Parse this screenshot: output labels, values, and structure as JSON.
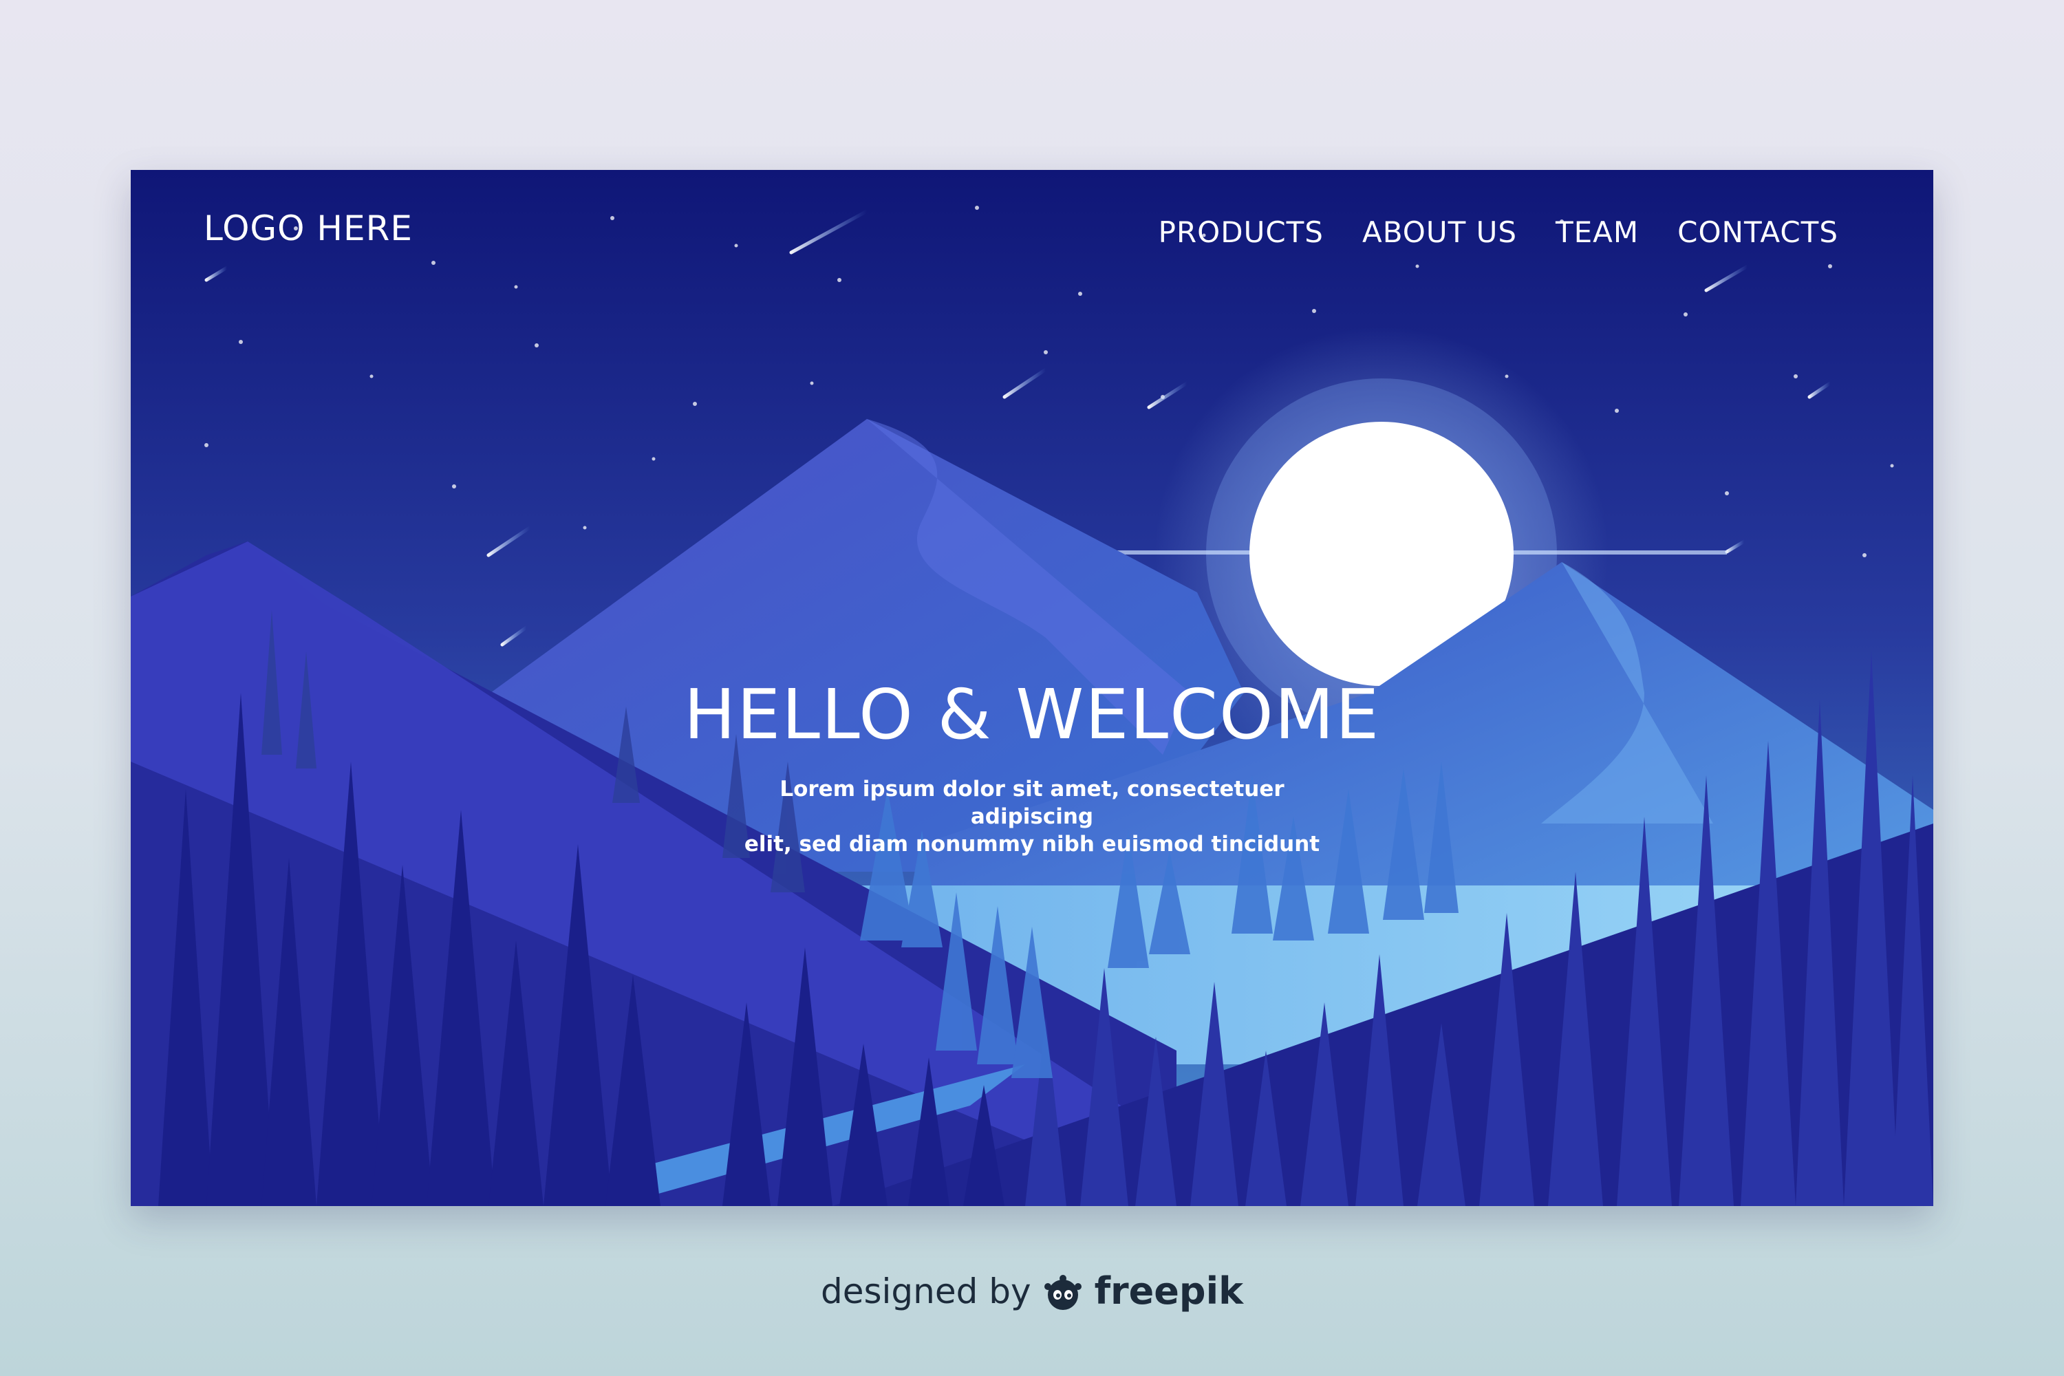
{
  "header": {
    "logo": "LOGO HERE",
    "nav": [
      {
        "label": "PRODUCTS"
      },
      {
        "label": "ABOUT US"
      },
      {
        "label": "TEAM"
      },
      {
        "label": "CONTACTS"
      }
    ]
  },
  "hero": {
    "title": "HELLO & WELCOME",
    "subtitle_line1": "Lorem ipsum dolor sit amet, consectetuer adipiscing",
    "subtitle_line2": "elit, sed diam nonummy nibh euismod tincidunt"
  },
  "footer": {
    "credit_prefix": "designed by",
    "credit_icon": "freepik-logo-icon",
    "credit_brand": "freepik"
  },
  "colors": {
    "sky_top": "#0f1677",
    "sky_bottom": "#3e7ec7",
    "moon": "#ffffff",
    "lake": "#7ec6ee",
    "forest_dark": "#1a1d8a",
    "page_background": "#e4e6ef"
  }
}
